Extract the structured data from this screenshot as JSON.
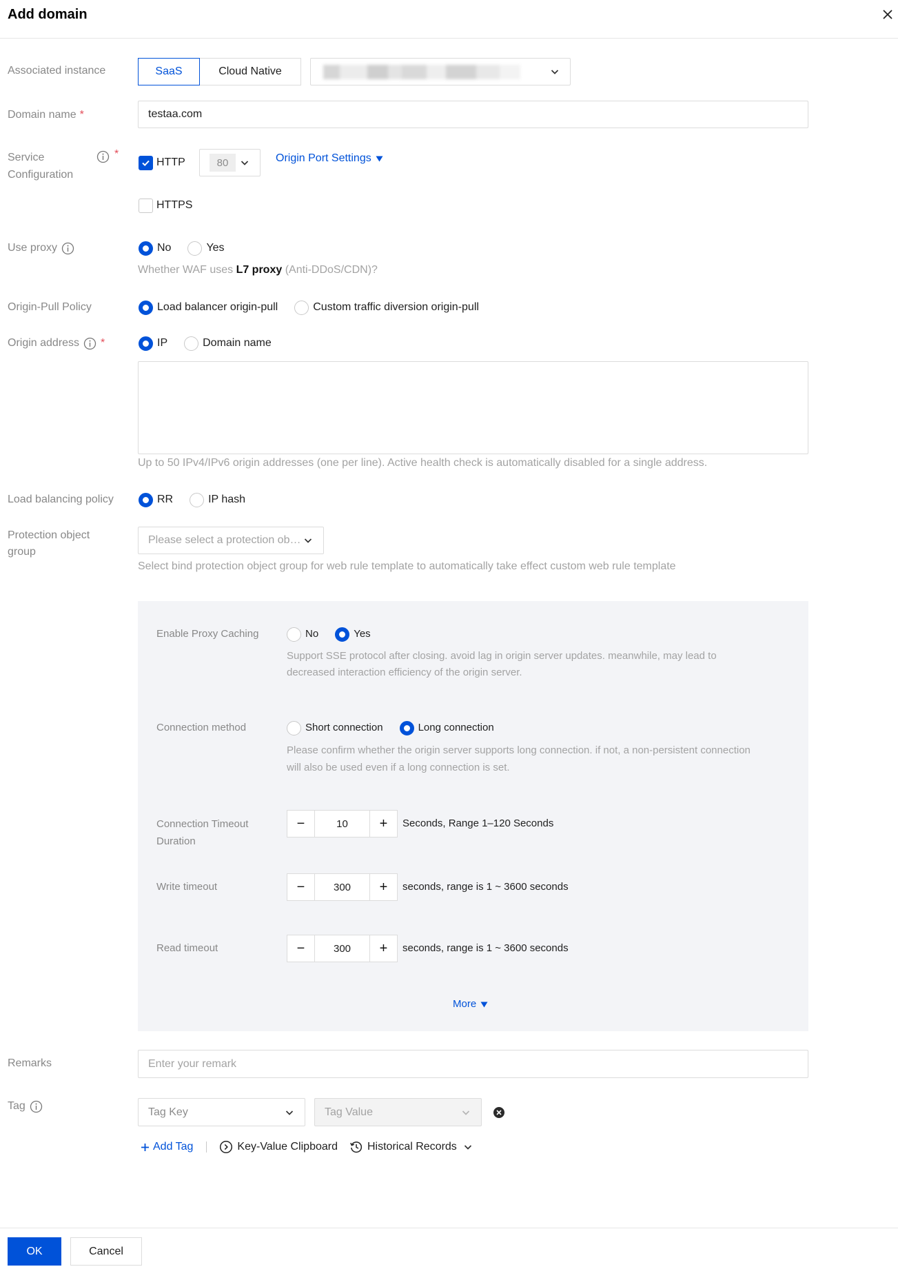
{
  "dialog": {
    "title": "Add domain"
  },
  "associated_instance": {
    "label": "Associated instance",
    "options": [
      "SaaS",
      "Cloud Native"
    ],
    "selected": "SaaS"
  },
  "domain_name": {
    "label": "Domain name",
    "required": "*",
    "value": "testaa.com"
  },
  "service_config": {
    "label": "Service Configuration",
    "required": "*",
    "http": {
      "label": "HTTP",
      "checked": true,
      "port": "80"
    },
    "origin_port_settings": "Origin Port Settings",
    "https": {
      "label": "HTTPS",
      "checked": false
    }
  },
  "use_proxy": {
    "label": "Use proxy",
    "options": [
      "No",
      "Yes"
    ],
    "selected": "No",
    "hint": {
      "prefix": "Whether WAF uses ",
      "emphasis": "L7 proxy",
      "suffix": " (Anti-DDoS/CDN)?"
    }
  },
  "origin_pull_policy": {
    "label": "Origin-Pull Policy",
    "options": [
      "Load balancer origin-pull",
      "Custom traffic diversion origin-pull"
    ],
    "selected": "Load balancer origin-pull"
  },
  "origin_address": {
    "label": "Origin address",
    "required": "*",
    "options": [
      "IP",
      "Domain name"
    ],
    "selected": "IP",
    "hint": "Up to 50 IPv4/IPv6 origin addresses (one per line). Active health check is automatically disabled for a single address."
  },
  "load_balancing_policy": {
    "label": "Load balancing policy",
    "options": [
      "RR",
      "IP hash"
    ],
    "selected": "RR"
  },
  "protection_object_group": {
    "label": "Protection object group",
    "placeholder": "Please select a protection ob…",
    "hint": "Select bind protection object group for web rule template to automatically take effect custom web rule template"
  },
  "advanced": {
    "proxy_caching": {
      "label": "Enable Proxy Caching",
      "options": [
        "No",
        "Yes"
      ],
      "selected": "Yes",
      "hint_lines": [
        "Support SSE protocol after closing. avoid lag in origin server updates. meanwhile, may lead to",
        "decreased interaction efficiency of the origin server."
      ]
    },
    "connection_method": {
      "label": "Connection method",
      "options": [
        "Short connection",
        "Long connection"
      ],
      "selected": "Long connection",
      "hint_lines": [
        "Please confirm whether the origin server supports long connection. if not, a non-persistent connection",
        "will also be used even if a long connection is set."
      ]
    },
    "connection_timeout": {
      "label": "Connection Timeout Duration",
      "value": "10",
      "unit": "Seconds, Range 1–120 Seconds"
    },
    "write_timeout": {
      "label": "Write timeout",
      "value": "300",
      "unit": "seconds, range is 1 ~ 3600 seconds"
    },
    "read_timeout": {
      "label": "Read timeout",
      "value": "300",
      "unit": "seconds, range is 1 ~ 3600 seconds"
    },
    "stepper": {
      "decrement": "−",
      "increment": "+"
    },
    "more": "More"
  },
  "remarks": {
    "label": "Remarks",
    "placeholder": "Enter your remark"
  },
  "tag": {
    "label": "Tag",
    "key_placeholder": "Tag Key",
    "value_placeholder": "Tag Value",
    "add_tag": "Add Tag",
    "clipboard": "Key-Value Clipboard",
    "history": "Historical Records"
  },
  "footer": {
    "ok": "OK",
    "cancel": "Cancel"
  },
  "colors": {
    "primary": "#0052d9",
    "required": "#e34d59",
    "panel_background": "#f3f4f7"
  },
  "icons": [
    "close-icon",
    "info-icon",
    "check-icon",
    "chevron-down-icon",
    "caret-down-icon",
    "plus-icon",
    "play-circle-icon",
    "history-icon",
    "clear-icon"
  ]
}
